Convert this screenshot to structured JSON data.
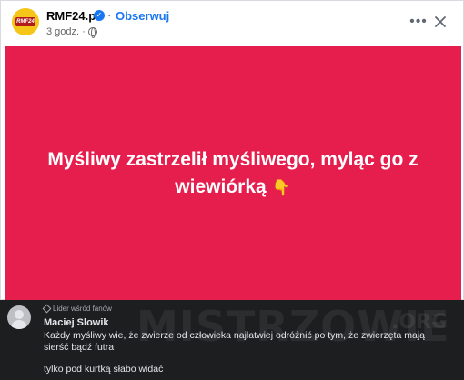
{
  "post": {
    "page_name": "RMF24.pl",
    "follow_label": "Obserwuj",
    "time": "3 godz.",
    "logo_text": "RMF24",
    "headline": "Myśliwy zastrzelił myśliwego, myląc go z wiewiórką",
    "emoji": "👇",
    "background_color": "#e61e4d"
  },
  "comment": {
    "badge": "Lider wśród fanów",
    "author": "Maciej Slowik",
    "text": "Każdy myśliwy wie, że zwierze od człowieka najłatwiej odróżnić po tym, że zwierzęta mają sierść bądź futra",
    "reply": "tylko pod kurtką słabo widać"
  },
  "watermark": {
    "main": "MISTRZOWIE",
    "suffix": ".ORG"
  },
  "icons": [
    "verified-icon",
    "globe-icon",
    "more-icon",
    "close-icon",
    "user-avatar-icon",
    "diamond-icon"
  ]
}
